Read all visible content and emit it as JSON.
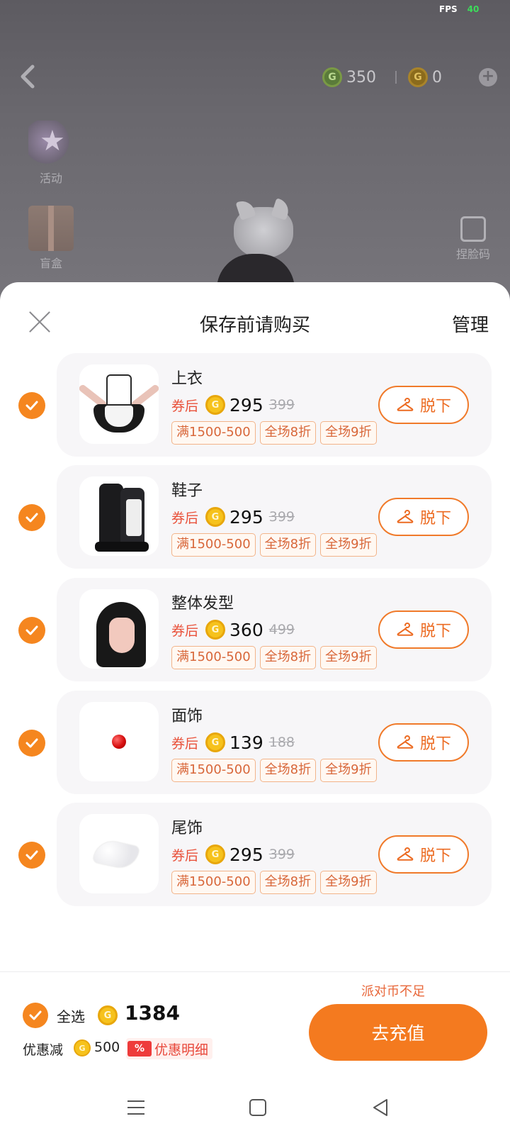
{
  "status": {
    "fps_label": "FPS",
    "fps_value": "40"
  },
  "top_bar": {
    "green_coin_symbol": "G",
    "green_currency": "350",
    "gold_coin_symbol": "G",
    "gold_currency": "0",
    "add_symbol": "+"
  },
  "side_menu": {
    "activity_label": "活动",
    "blind_box_label": "盲盒",
    "pinch_face_label": "捏脸码"
  },
  "sheet": {
    "title": "保存前请购买",
    "manage_label": "管理"
  },
  "coin_symbol": "G",
  "items": [
    {
      "name": "上衣",
      "after_coupon": "券后",
      "price": "295",
      "original_price": "399",
      "tags": [
        "满1500-500",
        "全场8折",
        "全场9折"
      ],
      "remove_label": "脱下",
      "checked": true
    },
    {
      "name": "鞋子",
      "after_coupon": "券后",
      "price": "295",
      "original_price": "399",
      "tags": [
        "满1500-500",
        "全场8折",
        "全场9折"
      ],
      "remove_label": "脱下",
      "checked": true
    },
    {
      "name": "整体发型",
      "after_coupon": "券后",
      "price": "360",
      "original_price": "499",
      "tags": [
        "满1500-500",
        "全场8折",
        "全场9折"
      ],
      "remove_label": "脱下",
      "checked": true
    },
    {
      "name": "面饰",
      "after_coupon": "券后",
      "price": "139",
      "original_price": "188",
      "tags": [
        "满1500-500",
        "全场8折",
        "全场9折"
      ],
      "remove_label": "脱下",
      "checked": true
    },
    {
      "name": "尾饰",
      "after_coupon": "券后",
      "price": "295",
      "original_price": "399",
      "tags": [
        "满1500-500",
        "全场8折",
        "全场9折"
      ],
      "remove_label": "脱下",
      "checked": true
    }
  ],
  "footer": {
    "insufficient_text": "派对币不足",
    "select_all_label": "全选",
    "total": "1384",
    "discount_label": "优惠减",
    "discount_value": "500",
    "detail_icon": "%",
    "detail_label": "优惠明细",
    "recharge_label": "去充值"
  },
  "colors": {
    "accent_orange": "#f5861f",
    "coupon_red": "#e9513a",
    "coin_gold": "#f6c21c"
  },
  "icons": {
    "back": "chevron-left-icon",
    "close": "close-icon",
    "check": "checkmark-icon",
    "hanger": "hanger-icon",
    "coin": "coin-icon"
  }
}
